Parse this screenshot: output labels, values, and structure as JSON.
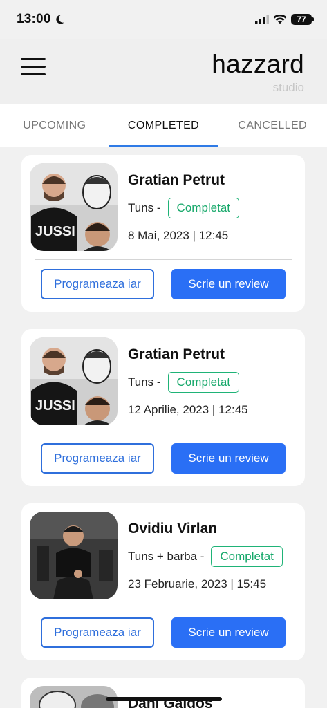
{
  "status_bar": {
    "time": "13:00",
    "battery": "77"
  },
  "header": {
    "title": "hazzard",
    "subtitle": "studio"
  },
  "tabs": [
    {
      "label": "UPCOMING",
      "active": false
    },
    {
      "label": "COMPLETED",
      "active": true
    },
    {
      "label": "CANCELLED",
      "active": false
    }
  ],
  "appointments": [
    {
      "name": "Gratian Petrut",
      "service": "Tuns -",
      "status": "Completat",
      "date": "8 Mai, 2023 | 12:45",
      "rebook_label": "Programeaza iar",
      "review_label": "Scrie un review"
    },
    {
      "name": "Gratian Petrut",
      "service": "Tuns -",
      "status": "Completat",
      "date": "12 Aprilie, 2023 | 12:45",
      "rebook_label": "Programeaza iar",
      "review_label": "Scrie un review"
    },
    {
      "name": "Ovidiu Virlan",
      "service": "Tuns + barba -",
      "status": "Completat",
      "date": "23 Februarie, 2023 | 15:45",
      "rebook_label": "Programeaza iar",
      "review_label": "Scrie un review"
    },
    {
      "name": "Dani Galdos"
    }
  ],
  "colors": {
    "accent": "#2f7be6",
    "status_green": "#1fb377",
    "button_blue": "#2a6ff5"
  }
}
